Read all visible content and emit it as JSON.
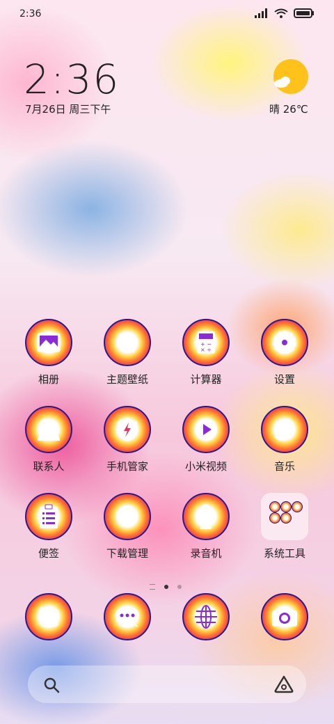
{
  "status_bar": {
    "time": "2:36"
  },
  "lockscreen_widget": {
    "clock": "2:36",
    "date": "7月26日 周三下午",
    "weather": "晴 26℃"
  },
  "apps": [
    {
      "label": "相册",
      "icon": "gallery-icon"
    },
    {
      "label": "主题壁纸",
      "icon": "paintbrush-icon"
    },
    {
      "label": "计算器",
      "icon": "calculator-icon"
    },
    {
      "label": "设置",
      "icon": "gear-icon"
    },
    {
      "label": "联系人",
      "icon": "contact-icon"
    },
    {
      "label": "手机管家",
      "icon": "shield-icon"
    },
    {
      "label": "小米视频",
      "icon": "play-icon"
    },
    {
      "label": "音乐",
      "icon": "music-note-icon"
    },
    {
      "label": "便签",
      "icon": "notepad-icon"
    },
    {
      "label": "下载管理",
      "icon": "download-icon"
    },
    {
      "label": "录音机",
      "icon": "microphone-icon"
    },
    {
      "label": "系统工具",
      "icon": "folder-icon"
    }
  ],
  "dock": [
    {
      "icon": "phone-icon"
    },
    {
      "icon": "message-icon"
    },
    {
      "icon": "browser-icon"
    },
    {
      "icon": "camera-icon"
    }
  ],
  "page_indicator": {
    "pages": 2,
    "active": 1
  }
}
